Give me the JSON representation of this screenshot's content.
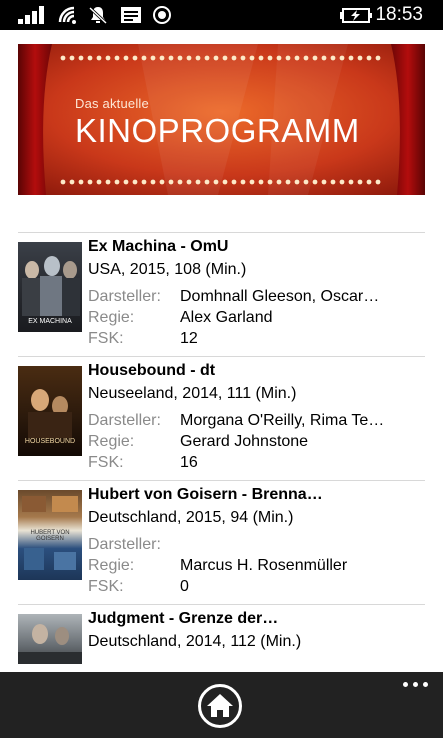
{
  "status_bar": {
    "time": "18:53",
    "icons": [
      "signal-icon",
      "wifi-icon",
      "bell-off-icon",
      "message-icon",
      "record-icon",
      "battery-charging-icon"
    ]
  },
  "banner": {
    "subtitle": "Das aktuelle",
    "title": "KINOPROGRAMM"
  },
  "labels": {
    "darsteller": "Darsteller:",
    "regie": "Regie:",
    "fsk": "FSK:"
  },
  "movies": [
    {
      "title": "Ex Machina - OmU",
      "meta": "USA, 2015, 108 (Min.)",
      "darsteller": "Domhnall Gleeson, Oscar…",
      "regie": "Alex Garland",
      "fsk": "12",
      "poster_caption": "EX MACHINA"
    },
    {
      "title": "Housebound - dt",
      "meta": "Neuseeland, 2014, 111 (Min.)",
      "darsteller": "Morgana O'Reilly, Rima Te…",
      "regie": "Gerard Johnstone",
      "fsk": "16",
      "poster_caption": "HOUSEBOUND"
    },
    {
      "title": "Hubert von Goisern - Brenna…",
      "meta": "Deutschland, 2015, 94 (Min.)",
      "darsteller": "",
      "regie": "Marcus H. Rosenmüller",
      "fsk": "0",
      "poster_caption": "HUBERT VON GOISERN"
    },
    {
      "title": "Judgment - Grenze der…",
      "meta": "Deutschland, 2014, 112 (Min.)"
    }
  ],
  "app_bar": {
    "home_icon": "home-icon",
    "more_icon": "more-dots-icon"
  }
}
